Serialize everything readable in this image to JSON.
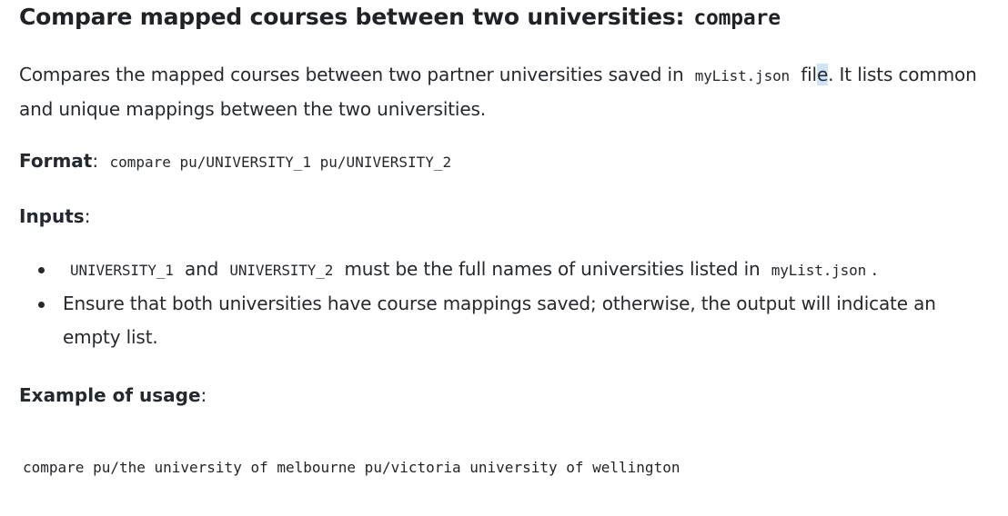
{
  "heading": {
    "text": "Compare mapped courses between two universities:",
    "command": "compare"
  },
  "description": {
    "part1": "Compares the mapped courses between two partner universities saved in",
    "filename": "myList.json",
    "part2_fil": "fil",
    "part2_e": "e",
    "part3": ". It lists common and unique mappings between the two universities."
  },
  "format": {
    "label": "Format",
    "colon": ":",
    "value": "compare pu/UNIVERSITY_1 pu/UNIVERSITY_2"
  },
  "inputs": {
    "label": "Inputs",
    "colon": ":",
    "items": [
      {
        "code1": "UNIVERSITY_1",
        "and": "and",
        "code2": "UNIVERSITY_2",
        "text": "must be the full names of universities listed in",
        "code3": "myList.json",
        "end": "."
      },
      {
        "text": "Ensure that both universities have course mappings saved; otherwise, the output will indicate an empty list."
      }
    ]
  },
  "example": {
    "label": "Example of usage",
    "colon": ":",
    "code": "compare pu/the university of melbourne pu/victoria university of wellington"
  }
}
